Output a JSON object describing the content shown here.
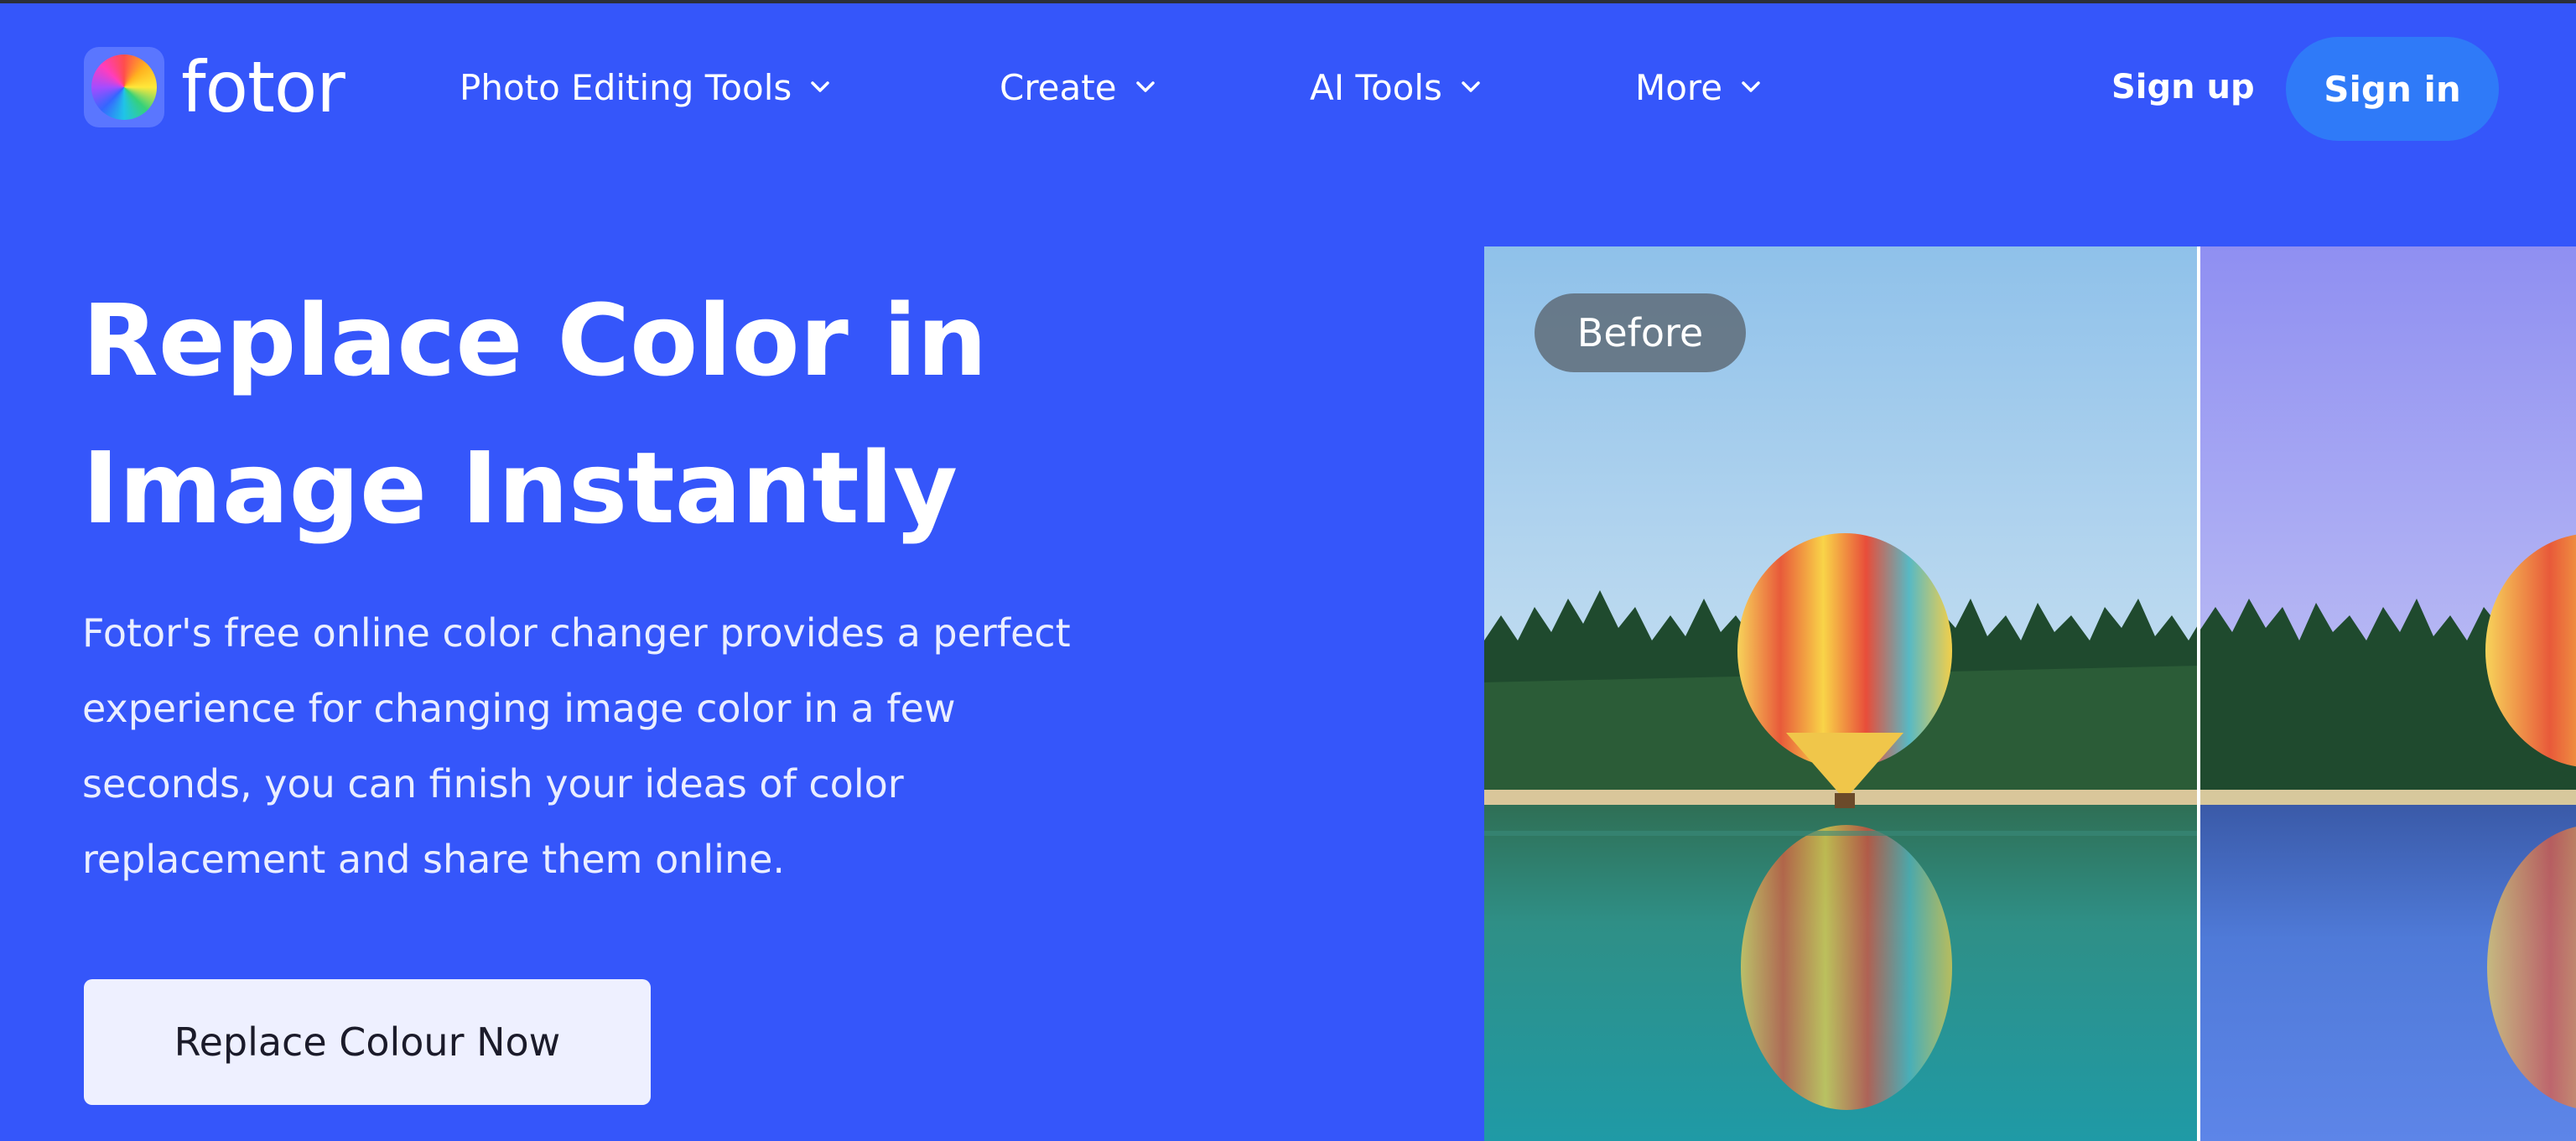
{
  "brand": {
    "name": "fotor"
  },
  "nav": {
    "items": [
      {
        "label": "Photo Editing Tools",
        "icon": "chevron-down-icon"
      },
      {
        "label": "Create",
        "icon": "chevron-down-icon"
      },
      {
        "label": "AI Tools",
        "icon": "chevron-down-icon"
      },
      {
        "label": "More",
        "icon": "chevron-down-icon"
      }
    ],
    "signup_label": "Sign up",
    "signin_label": "Sign in"
  },
  "hero": {
    "title_line1": "Replace Color in",
    "title_line2": "Image Instantly",
    "desc_line1": "Fotor's free online color changer provides a perfect",
    "desc_line2": "experience for changing image color in a few",
    "desc_line3": "seconds, you can finish your ideas of color",
    "desc_line4": "replacement and share them online.",
    "cta_label": "Replace Colour Now"
  },
  "compare": {
    "before_label": "Before"
  },
  "colors": {
    "page_bg": "#3556fa",
    "signin_bg": "#2f7af8",
    "cta_bg": "#eef0ff"
  }
}
